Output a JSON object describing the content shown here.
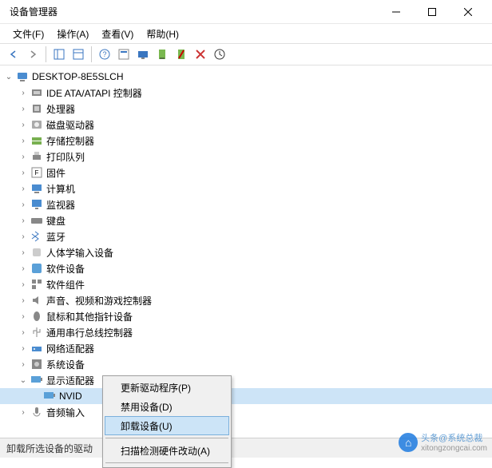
{
  "window": {
    "title": "设备管理器"
  },
  "menubar": {
    "file": "文件(F)",
    "action": "操作(A)",
    "view": "查看(V)",
    "help": "帮助(H)"
  },
  "toolbar": {
    "back": "←",
    "forward": "→"
  },
  "tree": {
    "root": "DESKTOP-8E5SLCH",
    "items": [
      {
        "label": "IDE ATA/ATAPI 控制器",
        "icon": "ide"
      },
      {
        "label": "处理器",
        "icon": "cpu"
      },
      {
        "label": "磁盘驱动器",
        "icon": "disk"
      },
      {
        "label": "存储控制器",
        "icon": "storage"
      },
      {
        "label": "打印队列",
        "icon": "printer"
      },
      {
        "label": "固件",
        "icon": "firmware"
      },
      {
        "label": "计算机",
        "icon": "computer"
      },
      {
        "label": "监视器",
        "icon": "monitor"
      },
      {
        "label": "键盘",
        "icon": "keyboard"
      },
      {
        "label": "蓝牙",
        "icon": "bluetooth"
      },
      {
        "label": "人体学输入设备",
        "icon": "hid"
      },
      {
        "label": "软件设备",
        "icon": "software"
      },
      {
        "label": "软件组件",
        "icon": "component"
      },
      {
        "label": "声音、视频和游戏控制器",
        "icon": "audio"
      },
      {
        "label": "鼠标和其他指针设备",
        "icon": "mouse"
      },
      {
        "label": "通用串行总线控制器",
        "icon": "usb"
      },
      {
        "label": "网络适配器",
        "icon": "network"
      },
      {
        "label": "系统设备",
        "icon": "system"
      }
    ],
    "display_adapter": {
      "label": "显示适配器",
      "child": "NVID",
      "sibling": "音频输入"
    }
  },
  "context_menu": {
    "update": "更新驱动程序(P)",
    "disable": "禁用设备(D)",
    "uninstall": "卸载设备(U)",
    "scan": "扫描检测硬件改动(A)"
  },
  "statusbar": {
    "text": "卸载所选设备的驱动"
  },
  "watermark": {
    "line1": "头条@系统总裁",
    "line2": "xitongzongcai.com"
  }
}
